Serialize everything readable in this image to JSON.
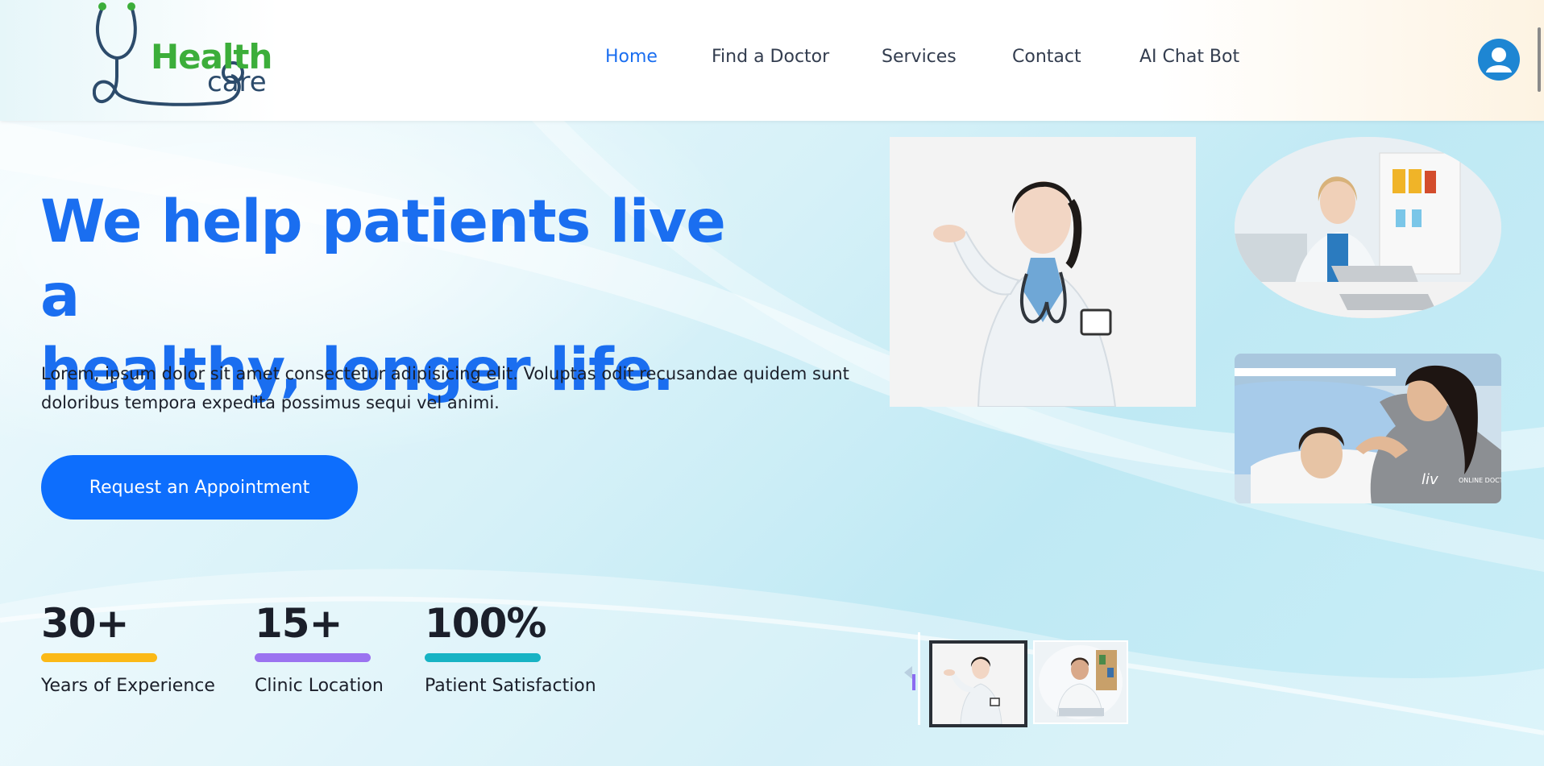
{
  "brand": {
    "logo_word_1": "Health",
    "logo_word_2": "care"
  },
  "nav": {
    "items": [
      {
        "label": "Home",
        "active": true
      },
      {
        "label": "Find a Doctor",
        "active": false
      },
      {
        "label": "Services",
        "active": false
      },
      {
        "label": "Contact",
        "active": false
      },
      {
        "label": "AI Chat Bot",
        "active": false
      }
    ]
  },
  "hero": {
    "title_line_1": "We help patients live a",
    "title_line_2": "healthy, longer life.",
    "description": "Lorem, ipsum dolor sit amet consectetur adipisicing elit. Voluptas odit recusandae quidem sunt doloribus tempora expedita possimus sequi vel animi.",
    "cta_label": "Request an Appointment"
  },
  "stats": [
    {
      "value": "30+",
      "label": "Years of Experience",
      "color": "#fbb917"
    },
    {
      "value": "15+",
      "label": "Clinic Location",
      "color": "#9b73f0"
    },
    {
      "value": "100%",
      "label": "Patient Satisfaction",
      "color": "#17b3c4"
    }
  ],
  "images": {
    "main": "doctor-woman-pointing-image",
    "top_right": "doctor-at-laptop-image",
    "bottom_right": "mother-and-child-in-hospital-bed-image",
    "watermark_left": "liv",
    "watermark_right": "ONLINE DOCTOR"
  },
  "carousel": {
    "thumbnails": [
      "doctor-woman-thumbnail",
      "doctor-man-thumbnail"
    ],
    "selected_index": 0
  },
  "colors": {
    "primary": "#1a6ef0",
    "button": "#0d6efd",
    "text_dark": "#1b1f2a",
    "logo_green": "#3cae3a",
    "logo_navy": "#2c4b6b"
  }
}
